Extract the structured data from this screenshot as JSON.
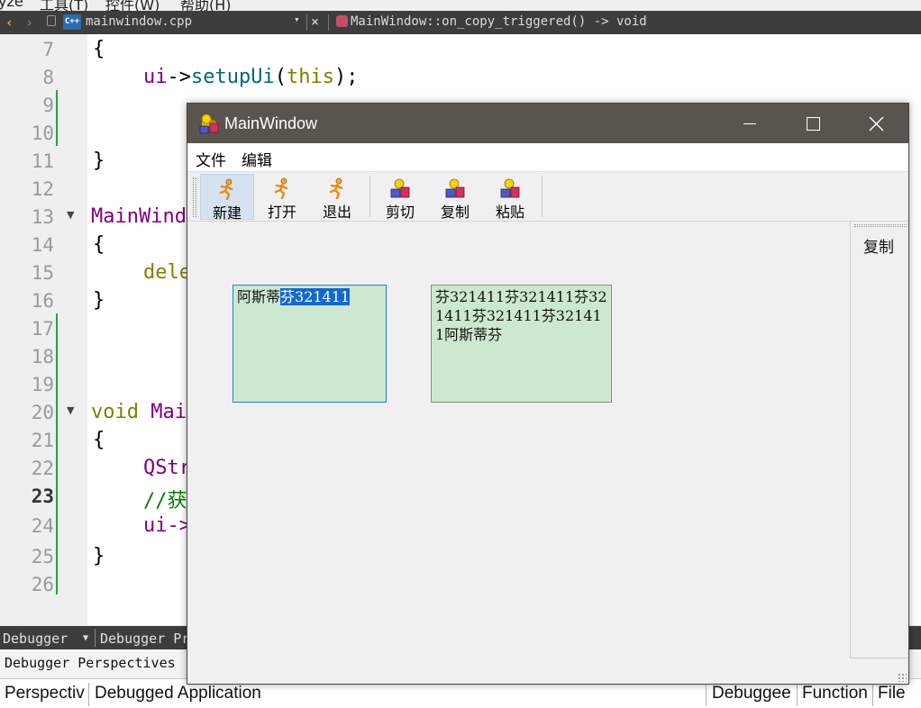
{
  "ide": {
    "menu": [
      "yze",
      "工具(T)",
      "控件(W)",
      "帮助(H)"
    ],
    "file_name": "mainwindow.cpp",
    "file_icon_text": "C++",
    "function_label": "MainWindow::on_copy_triggered() -> void",
    "line_numbers": [
      "7",
      "8",
      "9",
      "10",
      "11",
      "12",
      "13",
      "14",
      "15",
      "16",
      "17",
      "18",
      "19",
      "20",
      "21",
      "22",
      "23",
      "24",
      "25",
      "26"
    ],
    "current_line": "23",
    "code": {
      "l7": "{",
      "l8_a": "ui",
      "l8_b": "->",
      "l8_c": "setupUi",
      "l8_d": "(",
      "l8_e": "this",
      "l8_f": ");",
      "l11": "}",
      "l13": "MainWind",
      "l14": "{",
      "l15": "dele",
      "l16": "}",
      "l20_a": "void",
      "l20_b": " Mai",
      "l21": "{",
      "l22": "QStr",
      "l23": "//获",
      "l24": "ui->",
      "l25": "}"
    },
    "debug_tabs": {
      "debugger_dropdown": "Debugger",
      "debugger_pr": "Debugger Pr",
      "perspectives": "Debugger Perspectives",
      "perspectiv": "Perspectiv",
      "debugged_app": "Debugged Application",
      "debuggee": "Debuggee",
      "function": "Function",
      "file": "File"
    }
  },
  "window": {
    "title": "MainWindow",
    "menus": [
      "文件",
      "编辑"
    ],
    "toolbar": [
      {
        "label": "新建",
        "icon": "person-run-icon",
        "active": true
      },
      {
        "label": "打开",
        "icon": "person-run-icon",
        "active": false
      },
      {
        "label": "退出",
        "icon": "person-run-icon",
        "active": false
      },
      {
        "label": "剪切",
        "icon": "shapes-icon",
        "active": false
      },
      {
        "label": "复制",
        "icon": "shapes-icon",
        "active": false
      },
      {
        "label": "粘贴",
        "icon": "shapes-icon",
        "active": false
      }
    ],
    "edit1": {
      "plain": "阿斯蒂",
      "selected": "芬321411"
    },
    "edit2": {
      "text": "芬321411芬321411芬321411芬321411芬321411阿斯蒂芬"
    },
    "dock_label": "复制"
  },
  "colors": {
    "accent": "#1168d2",
    "text_edit_bg": "#cde8d0",
    "title_bar": "#5a544f",
    "git_bar": "#2e9e3e"
  }
}
